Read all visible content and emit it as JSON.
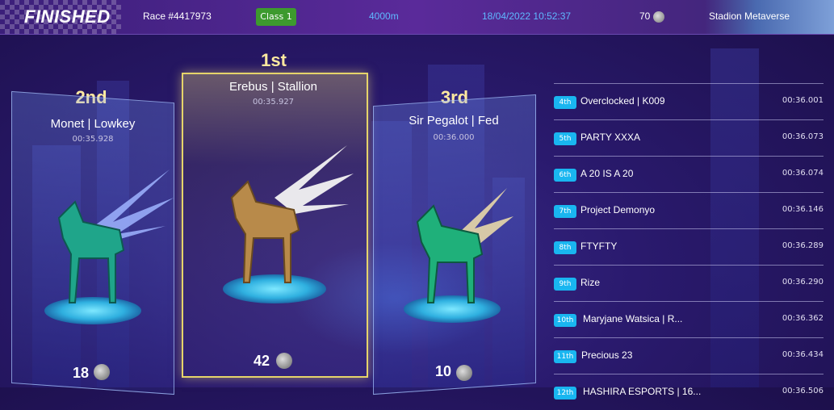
{
  "header": {
    "status": "FINISHED",
    "race_id": "Race #4417973",
    "race_class": "Class 1",
    "distance": "4000m",
    "datetime": "18/04/2022 10:52:37",
    "prize": "70",
    "venue": "Stadion Metaverse"
  },
  "podium": [
    {
      "rank": "2nd",
      "name": "Monet | Lowkey",
      "time": "00:35.928",
      "points": "18",
      "icon": "coin-icon"
    },
    {
      "rank": "1st",
      "name": "Erebus | Stallion",
      "time": "00:35.927",
      "points": "42",
      "icon": "coin-icon"
    },
    {
      "rank": "3rd",
      "name": "Sir Pegalot | Fed",
      "time": "00:36.000",
      "points": "10",
      "icon": "coin-icon"
    }
  ],
  "results": [
    {
      "pos": "4th",
      "name": "Overclocked | K009",
      "time": "00:36.001"
    },
    {
      "pos": "5th",
      "name": "PARTY XXXA",
      "time": "00:36.073"
    },
    {
      "pos": "6th",
      "name": "A 20 IS A 20",
      "time": "00:36.074"
    },
    {
      "pos": "7th",
      "name": "Project Demonyo",
      "time": "00:36.146"
    },
    {
      "pos": "8th",
      "name": "FTYFTY",
      "time": "00:36.289"
    },
    {
      "pos": "9th",
      "name": "Rize",
      "time": "00:36.290"
    },
    {
      "pos": "10th",
      "name": "Maryjane Watsica | R...",
      "time": "00:36.362"
    },
    {
      "pos": "11th",
      "name": "Precious 23",
      "time": "00:36.434"
    },
    {
      "pos": "12th",
      "name": "HASHIRA ESPORTS | 16...",
      "time": "00:36.506"
    }
  ],
  "colors": {
    "accent": "#19b6f0",
    "class_badge": "#3d9a2e",
    "gold": "#e6d46a"
  }
}
